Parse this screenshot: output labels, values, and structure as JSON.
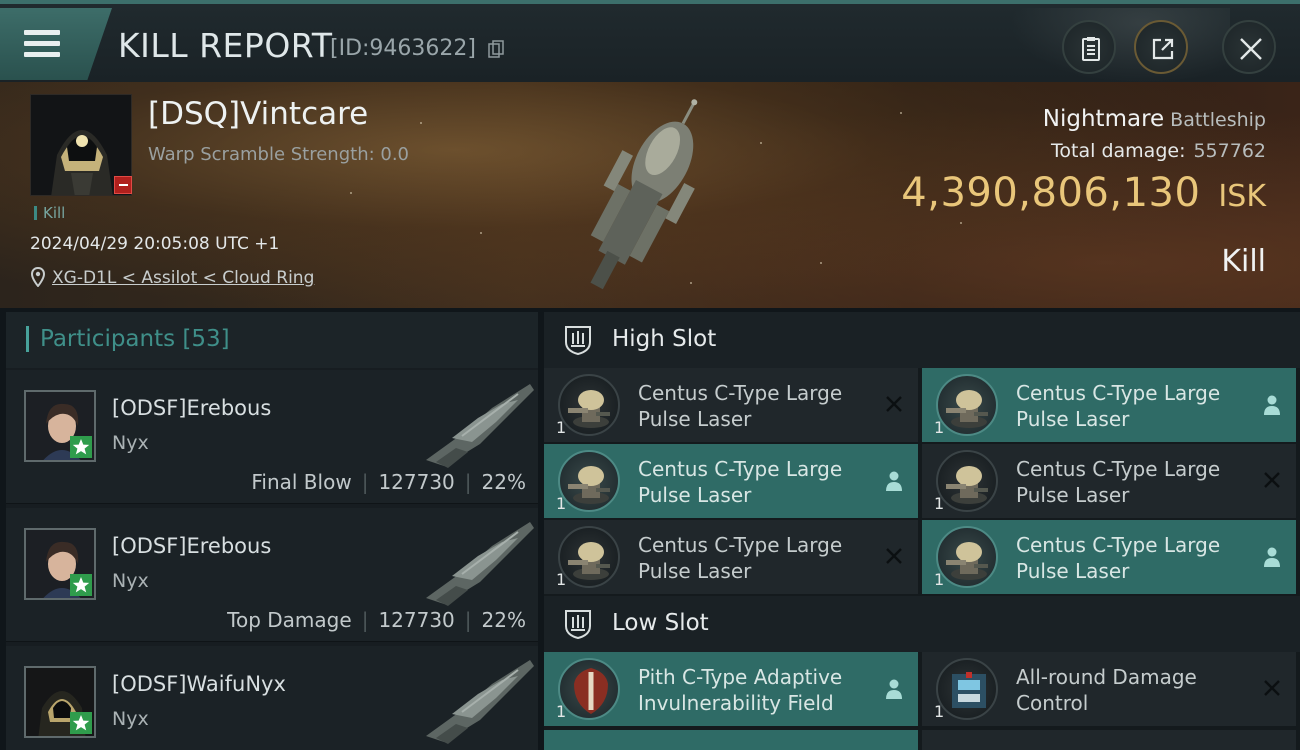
{
  "header": {
    "title": "KILL REPORT",
    "report_id": "[ID:9463622]"
  },
  "victim": {
    "name": "[DSQ]Vintcare",
    "warp_scramble": "Warp Scramble Strength: 0.0",
    "tag": "Kill",
    "timestamp": "2024/04/29 20:05:08 UTC +1",
    "location": "XG-D1L < Assilot < Cloud Ring",
    "ship_name": "Nightmare",
    "ship_class": "Battleship",
    "total_damage_label": "Total damage:",
    "total_damage": "557762",
    "isk_value": "4,390,806,130",
    "isk_unit": "ISK",
    "result": "Kill"
  },
  "participants": {
    "title": "Participants",
    "count": "[53]",
    "rows": [
      {
        "name": "[ODSF]Erebous",
        "ship": "Nyx",
        "role": "Final Blow",
        "damage": "127730",
        "percent": "22%"
      },
      {
        "name": "[ODSF]Erebous",
        "ship": "Nyx",
        "role": "Top Damage",
        "damage": "127730",
        "percent": "22%"
      },
      {
        "name": "[ODSF]WaifuNyx",
        "ship": "Nyx",
        "role": "",
        "damage": "",
        "percent": ""
      }
    ]
  },
  "slots": {
    "high_title": "High Slot",
    "low_title": "Low Slot",
    "high": [
      {
        "name": "Centus C-Type Large Pulse Laser",
        "qty": "1",
        "state": "destroyed"
      },
      {
        "name": "Centus C-Type Large Pulse Laser",
        "qty": "1",
        "state": "dropped"
      },
      {
        "name": "Centus C-Type Large Pulse Laser",
        "qty": "1",
        "state": "dropped"
      },
      {
        "name": "Centus C-Type Large Pulse Laser",
        "qty": "1",
        "state": "destroyed"
      },
      {
        "name": "Centus C-Type Large Pulse Laser",
        "qty": "1",
        "state": "destroyed"
      },
      {
        "name": "Centus C-Type Large Pulse Laser",
        "qty": "1",
        "state": "dropped"
      }
    ],
    "low": [
      {
        "name": "Pith C-Type Adaptive Invulnerability Field",
        "qty": "1",
        "state": "dropped"
      },
      {
        "name": "All-round Damage Control",
        "qty": "1",
        "state": "destroyed"
      }
    ]
  },
  "colors": {
    "accent": "#3f8f89",
    "isk": "#e9c67a",
    "dropped_bg": "#2f6b66",
    "destroyed_bg": "#20272b"
  }
}
